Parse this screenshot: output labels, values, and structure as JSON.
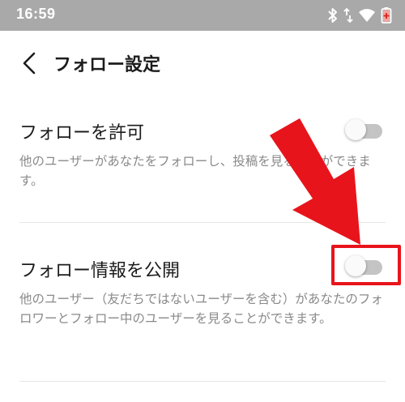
{
  "status_bar": {
    "time": "16:59",
    "icons": [
      "bluetooth-icon",
      "data-arrows-icon",
      "wifi-icon",
      "battery-saver-icon"
    ]
  },
  "header": {
    "back_icon": "chevron-left-icon",
    "title": "フォロー設定"
  },
  "settings": [
    {
      "title": "フォローを許可",
      "description": "他のユーザーがあなたをフォローし、投稿を見ることができます。",
      "enabled": false
    },
    {
      "title": "フォロー情報を公開",
      "description": "他のユーザー（友だちではないユーザーを含む）があなたのフォロワーとフォロー中のユーザーを見ることができます。",
      "enabled": false
    }
  ],
  "annotation": {
    "arrow_color": "#e8141b",
    "box_color": "#e8141b"
  },
  "colors": {
    "status_bar": "#a9a9a9",
    "toggle_off_track": "#c4c4c4",
    "description_text": "#8a8a8a"
  }
}
